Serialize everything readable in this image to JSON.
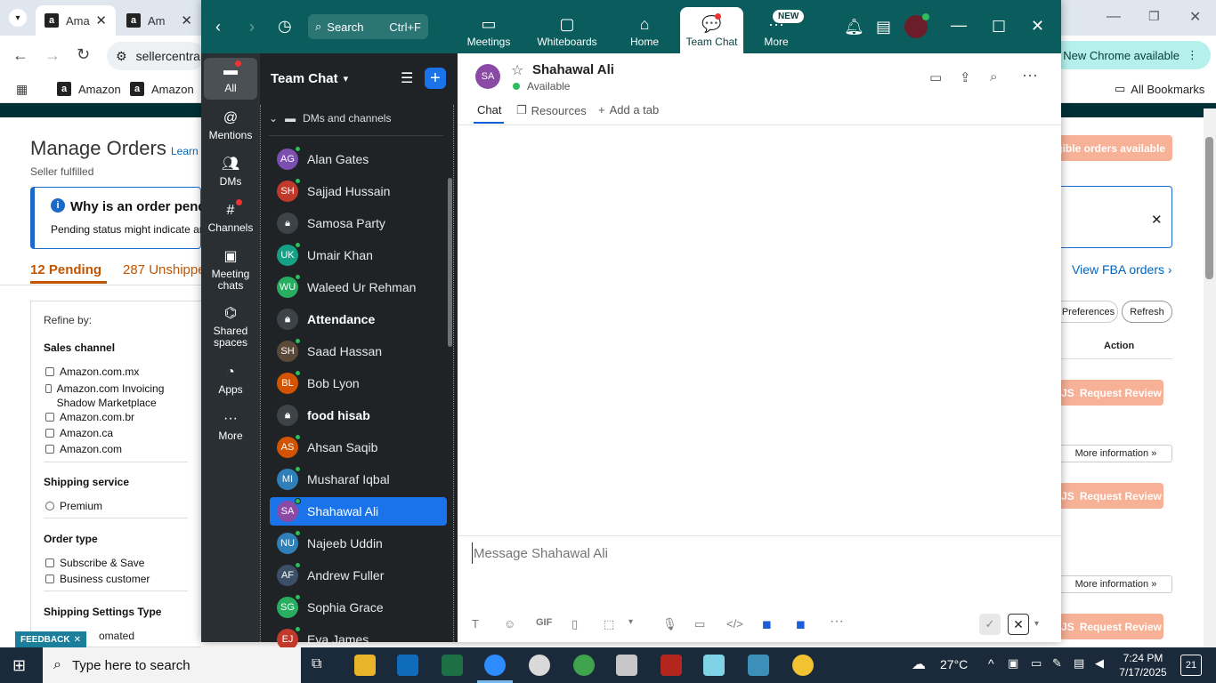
{
  "chrome": {
    "tabs": [
      {
        "label": "Ama",
        "active": true
      },
      {
        "label": "Am",
        "active": false
      }
    ],
    "address": "sellercentra",
    "bookmarks": [
      "Amazon",
      "Amazon"
    ],
    "all_bookmarks": "All Bookmarks",
    "new_chrome": "New Chrome available"
  },
  "amazon": {
    "title": "Manage Orders",
    "learn": "Learn",
    "subtitle": "Seller fulfilled",
    "why_title": "Why is an order pendi",
    "why_text": "Pending status might indicate an",
    "tab_pending": "12 Pending",
    "tab_unshipped": "287 Unshippe",
    "eligible_btn": "igible orders available",
    "view_fba": "View FBA orders",
    "preferences": "Preferences",
    "refresh": "Refresh",
    "action_header": "Action",
    "request_review": "Request Review",
    "more_information": "More information",
    "refine_by": "Refine by:",
    "sales_channel": "Sales channel",
    "channels": [
      "Amazon.com.mx",
      "Amazon.com Invoicing Shadow Marketplace",
      "Amazon.com.br",
      "Amazon.ca",
      "Amazon.com"
    ],
    "shipping_service": "Shipping service",
    "premium": "Premium",
    "order_type": "Order type",
    "order_types": [
      "Subscribe & Save",
      "Business customer"
    ],
    "shipping_settings": "Shipping Settings Type",
    "automated": "omated",
    "feedback": "FEEDBACK"
  },
  "zoom": {
    "search_label": "Search",
    "search_shortcut": "Ctrl+F",
    "nav": [
      {
        "label": "Meetings",
        "icon": "video-icon"
      },
      {
        "label": "Whiteboards",
        "icon": "whiteboard-icon"
      },
      {
        "label": "Home",
        "icon": "home-icon"
      },
      {
        "label": "Team Chat",
        "icon": "chat-icon"
      },
      {
        "label": "More",
        "icon": "more-icon"
      }
    ],
    "new_badge": "NEW",
    "rail": [
      {
        "label": "All",
        "icon": "chat-bubble-icon"
      },
      {
        "label": "Mentions",
        "icon": "at-icon"
      },
      {
        "label": "DMs",
        "icon": "people-icon"
      },
      {
        "label": "Channels",
        "icon": "hash-icon"
      },
      {
        "label": "Meeting chats",
        "icon": "calendar-icon"
      },
      {
        "label": "Shared spaces",
        "icon": "shared-icon"
      },
      {
        "label": "Apps",
        "icon": "apps-icon"
      },
      {
        "label": "More",
        "icon": "ellipsis-icon"
      }
    ],
    "team_chat_title": "Team Chat",
    "dms_channels": "DMs and channels",
    "contacts": [
      {
        "initials": "AG",
        "name": "Alan Gates",
        "color": "#7a4fb0",
        "bold": false,
        "lock": false
      },
      {
        "initials": "SH",
        "name": "Sajjad Hussain",
        "color": "#c0392b",
        "bold": false,
        "lock": false
      },
      {
        "initials": "",
        "name": "Samosa Party",
        "color": "#3e4347",
        "bold": false,
        "lock": true
      },
      {
        "initials": "UK",
        "name": "Umair Khan",
        "color": "#16a085",
        "bold": false,
        "lock": false
      },
      {
        "initials": "WU",
        "name": "Waleed Ur Rehman",
        "color": "#27ae60",
        "bold": false,
        "lock": false
      },
      {
        "initials": "",
        "name": "Attendance",
        "color": "#3e4347",
        "bold": true,
        "lock": true
      },
      {
        "initials": "SH",
        "name": "Saad Hassan",
        "color": "#5b4a3a",
        "bold": false,
        "lock": false
      },
      {
        "initials": "BL",
        "name": "Bob Lyon",
        "color": "#d35400",
        "bold": false,
        "lock": false
      },
      {
        "initials": "",
        "name": "food hisab",
        "color": "#3e4347",
        "bold": true,
        "lock": true
      },
      {
        "initials": "AS",
        "name": "Ahsan Saqib",
        "color": "#d35400",
        "bold": false,
        "lock": false
      },
      {
        "initials": "MI",
        "name": "Musharaf Iqbal",
        "color": "#2f80b8",
        "bold": false,
        "lock": false
      },
      {
        "initials": "SA",
        "name": "Shahawal Ali",
        "color": "#8a4aa6",
        "bold": false,
        "lock": false,
        "selected": true
      },
      {
        "initials": "NU",
        "name": "Najeeb Uddin",
        "color": "#2f80b8",
        "bold": false,
        "lock": false
      },
      {
        "initials": "AF",
        "name": "Andrew Fuller",
        "color": "#3b5068",
        "bold": false,
        "lock": false
      },
      {
        "initials": "SG",
        "name": "Sophia Grace",
        "color": "#27ae60",
        "bold": false,
        "lock": false
      },
      {
        "initials": "EJ",
        "name": "Eva James",
        "color": "#c0392b",
        "bold": false,
        "lock": false
      }
    ],
    "chat": {
      "initials": "SA",
      "name": "Shahawal Ali",
      "status": "Available",
      "tabs": [
        "Chat",
        "Resources",
        "Add a tab"
      ],
      "placeholder": "Message Shahawal Ali"
    }
  },
  "taskbar": {
    "search_placeholder": "Type here to search",
    "weather": "27°C",
    "time": "7:24 PM",
    "date": "7/17/2025",
    "notif_count": "21"
  }
}
